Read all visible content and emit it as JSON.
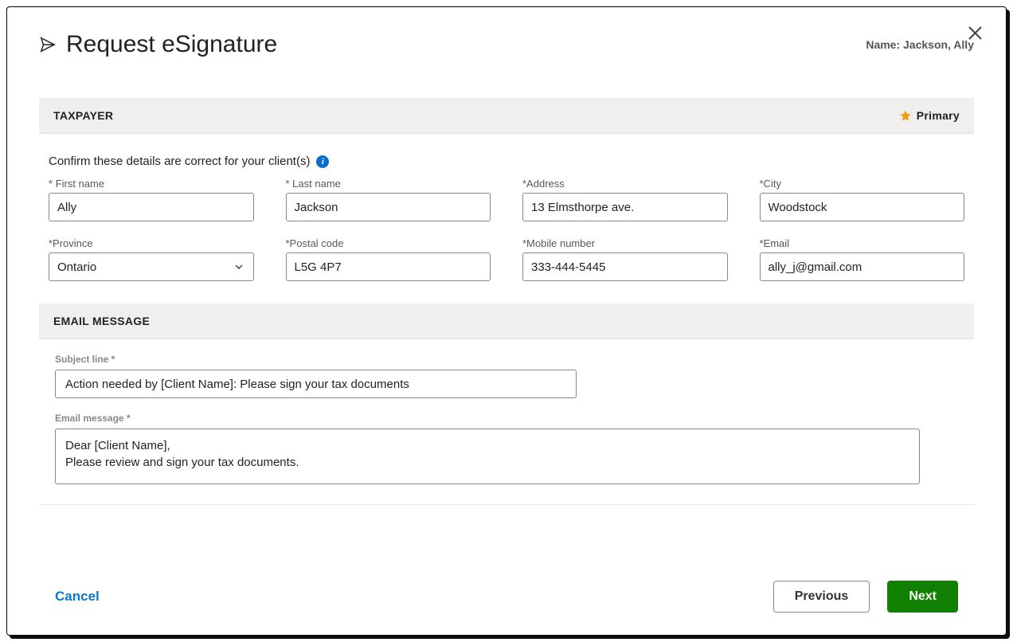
{
  "header": {
    "title": "Request eSignature",
    "name_prefix": "Name: ",
    "client_name": "Jackson, Ally"
  },
  "taxpayer_section": {
    "heading": "TAXPAYER",
    "primary_label": "Primary",
    "confirm_text": "Confirm these details are correct for your client(s)"
  },
  "fields": {
    "first_name": {
      "label": "* First name",
      "value": "Ally"
    },
    "last_name": {
      "label": "* Last name",
      "value": "Jackson"
    },
    "address": {
      "label": "*Address",
      "value": "13 Elmsthorpe ave."
    },
    "city": {
      "label": "*City",
      "value": "Woodstock"
    },
    "province": {
      "label": "*Province",
      "value": "Ontario"
    },
    "postal_code": {
      "label": "*Postal code",
      "value": "L5G 4P7"
    },
    "mobile": {
      "label": "*Mobile number",
      "value": "333-444-5445"
    },
    "email": {
      "label": "*Email",
      "value": "ally_j@gmail.com"
    }
  },
  "email_section": {
    "heading": "EMAIL MESSAGE",
    "subject_label": "Subject line *",
    "subject_value": "Action needed by [Client Name]: Please sign your tax documents",
    "message_label": "Email message *",
    "message_value": "Dear [Client Name],\nPlease review and sign your tax documents."
  },
  "footer": {
    "cancel": "Cancel",
    "previous": "Previous",
    "next": "Next"
  }
}
